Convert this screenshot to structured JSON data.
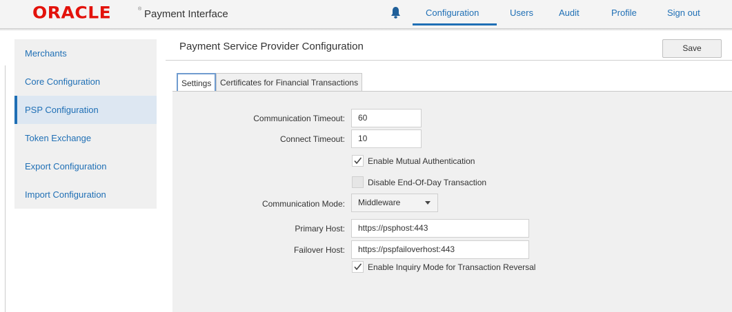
{
  "header": {
    "logo": "ORACLE",
    "logo_mark": "®",
    "app_name": "Payment Interface",
    "nav": [
      "Configuration",
      "Users",
      "Audit",
      "Profile",
      "Sign out"
    ],
    "active_nav": "Configuration"
  },
  "sidebar": {
    "items": [
      {
        "label": "Merchants"
      },
      {
        "label": "Core Configuration"
      },
      {
        "label": "PSP Configuration",
        "active": true
      },
      {
        "label": "Token Exchange"
      },
      {
        "label": "Export Configuration"
      },
      {
        "label": "Import Configuration"
      }
    ]
  },
  "main": {
    "title": "Payment Service Provider Configuration",
    "save_label": "Save",
    "tabs": [
      "Settings",
      "Certificates for Financial Transactions"
    ],
    "form": {
      "communication_timeout": {
        "label": "Communication Timeout:",
        "value": "60"
      },
      "connect_timeout": {
        "label": "Connect Timeout:",
        "value": "10"
      },
      "mutual_auth": {
        "label": "Enable Mutual Authentication",
        "checked": true
      },
      "disable_eod": {
        "label": "Disable End-Of-Day Transaction",
        "checked": false
      },
      "communication_mode": {
        "label": "Communication Mode:",
        "value": "Middleware"
      },
      "primary_host": {
        "label": "Primary Host:",
        "value": "https://psphost:443"
      },
      "failover_host": {
        "label": "Failover Host:",
        "value": "https://pspfailoverhost:443"
      },
      "inquiry_mode": {
        "label": "Enable Inquiry Mode for Transaction Reversal",
        "checked": true
      }
    }
  },
  "colors": {
    "accent": "#1f6fb5",
    "brand": "#e3120b",
    "sidebar_bg": "#f0f0f0",
    "active_bg": "#dde7f2"
  },
  "icons": {
    "bell": "bell-icon",
    "check": "check-icon",
    "dropdown": "chevron-down-icon"
  }
}
